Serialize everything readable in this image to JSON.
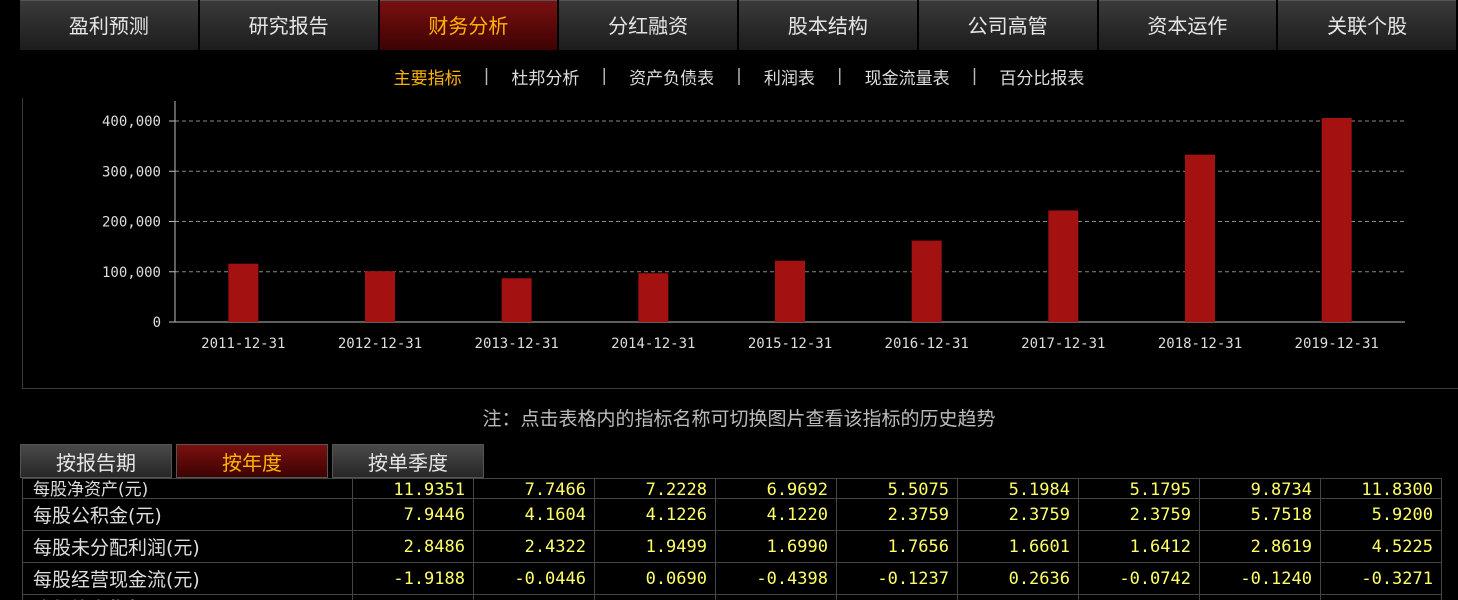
{
  "top_tabs": [
    "盈利预测",
    "研究报告",
    "财务分析",
    "分红融资",
    "股本结构",
    "公司高管",
    "资本运作",
    "关联个股"
  ],
  "active_top_tab": "财务分析",
  "sub_tabs": [
    "主要指标",
    "杜邦分析",
    "资产负债表",
    "利润表",
    "现金流量表",
    "百分比报表"
  ],
  "active_sub_tab": "主要指标",
  "sub_separator": "|",
  "chart_data": {
    "type": "bar",
    "categories": [
      "2011-12-31",
      "2012-12-31",
      "2013-12-31",
      "2014-12-31",
      "2015-12-31",
      "2016-12-31",
      "2017-12-31",
      "2018-12-31",
      "2019-12-31"
    ],
    "values": [
      116000,
      101000,
      87000,
      97000,
      122000,
      162000,
      222000,
      333000,
      406000
    ],
    "ylim": [
      0,
      400000
    ],
    "yticks": [
      0,
      100000,
      200000,
      300000,
      400000
    ],
    "ytick_labels": [
      "0",
      "100,000",
      "200,000",
      "300,000",
      "400,000"
    ],
    "grid": true,
    "bar_color": "#a31111",
    "grid_color": "#888888"
  },
  "note": "注：点击表格内的指标名称可切换图片查看该指标的历史趋势",
  "period_tabs": [
    "按报告期",
    "按年度",
    "按单季度"
  ],
  "active_period_tab": "按年度",
  "table": {
    "partial_top": {
      "label": "每股净资产(元)",
      "values": [
        "11.9351",
        "7.7466",
        "7.2228",
        "6.9692",
        "5.5075",
        "5.1984",
        "5.1795",
        "9.8734",
        "11.8300"
      ]
    },
    "rows": [
      {
        "label": "每股公积金(元)",
        "values": [
          "7.9446",
          "4.1604",
          "4.1226",
          "4.1220",
          "2.3759",
          "2.3759",
          "2.3759",
          "5.7518",
          "5.9200"
        ]
      },
      {
        "label": "每股未分配利润(元)",
        "values": [
          "2.8486",
          "2.4322",
          "1.9499",
          "1.6990",
          "1.7656",
          "1.6601",
          "1.6412",
          "2.8619",
          "4.5225"
        ]
      },
      {
        "label": "每股经营现金流(元)",
        "values": [
          "-1.9188",
          "-0.0446",
          "0.0690",
          "-0.4398",
          "-0.1237",
          "0.2636",
          "-0.0742",
          "-0.1240",
          "-0.3271"
        ]
      }
    ],
    "partial_bottom_label": "成长能力指标"
  }
}
